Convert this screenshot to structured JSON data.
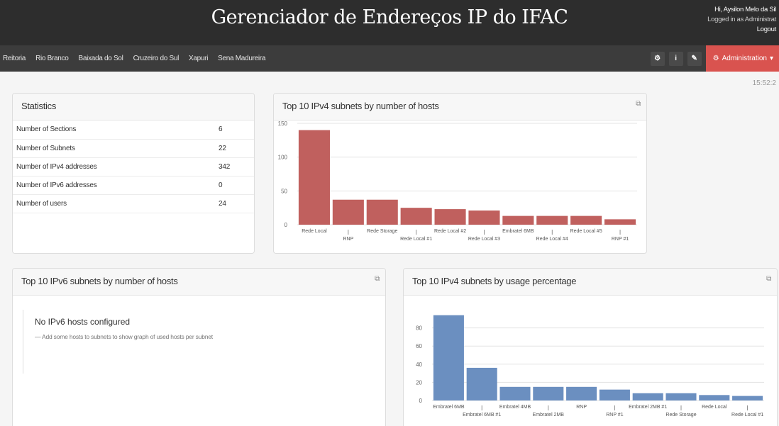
{
  "header": {
    "title": "Gerenciador de Endereços IP do IFAC",
    "greeting": "Hi, Aysilon Melo da Sil",
    "logged_as": "Logged in as Administrat",
    "logout": "Logout"
  },
  "nav": {
    "sections": [
      "Reitoria",
      "Rio Branco",
      "Baixada do Sol",
      "Cruzeiro do Sul",
      "Xapuri",
      "Sena Madureira"
    ],
    "tools": [
      {
        "icon": "dashboard-icon",
        "glyph": "⚙"
      },
      {
        "icon": "info-icon",
        "glyph": "i"
      },
      {
        "icon": "wrench-icon",
        "glyph": "✎"
      }
    ],
    "admin_label": "Administration",
    "admin_color": "#d9534f"
  },
  "clock": "15:52:2",
  "statistics": {
    "title": "Statistics",
    "rows": [
      {
        "label": "Number of Sections",
        "value": "6"
      },
      {
        "label": "Number of Subnets",
        "value": "22"
      },
      {
        "label": "Number of IPv4 addresses",
        "value": "342"
      },
      {
        "label": "Number of IPv6 addresses",
        "value": "0"
      },
      {
        "label": "Number of users",
        "value": "24"
      }
    ]
  },
  "ipv6_panel": {
    "title": "Top 10 IPv6 subnets by number of hosts",
    "empty_title": "No IPv6 hosts configured",
    "empty_hint": "— Add some hosts to subnets to show graph of used hosts per subnet"
  },
  "chart_data": [
    {
      "type": "bar",
      "title": "Top 10 IPv4 subnets by number of hosts",
      "categories": [
        "Rede Local",
        "RNP",
        "Rede Storage",
        "Rede Local #1",
        "Rede Local #2",
        "Rede Local #3",
        "Embratel 6MB",
        "Rede Local #4",
        "Rede Local #5",
        "RNP #1"
      ],
      "values": [
        140,
        37,
        37,
        25,
        23,
        21,
        13,
        13,
        13,
        8
      ],
      "yticks": [
        0,
        50,
        100,
        150
      ],
      "ylim": [
        0,
        150
      ],
      "color": "#c0605e",
      "grid": true
    },
    {
      "type": "bar",
      "title": "Top 10 IPv4 subnets by usage percentage",
      "categories": [
        "Embratel 6MB",
        "Embratel 6MB #1",
        "Embratel 4MB",
        "Embratel 2MB",
        "RNP",
        "RNP #1",
        "Embratel 2MB #1",
        "Rede Storage",
        "Rede Local",
        "Rede Local #1"
      ],
      "values": [
        94,
        36,
        15,
        15,
        15,
        12,
        8,
        8,
        6,
        5
      ],
      "yticks": [
        0,
        20,
        40,
        60,
        80
      ],
      "ylim": [
        0,
        100
      ],
      "color": "#6b8fc0",
      "grid": true
    }
  ]
}
